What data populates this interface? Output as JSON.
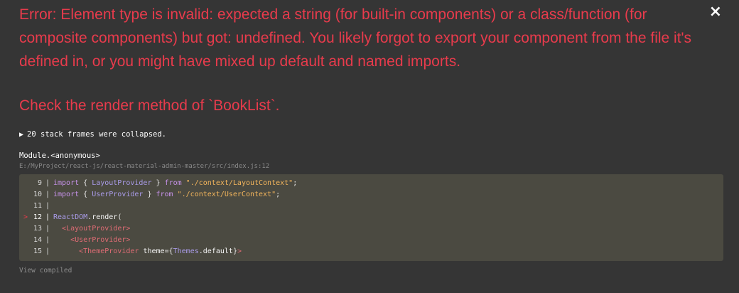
{
  "overlay": {
    "close_label": "×",
    "error_message": "Error: Element type is invalid: expected a string (for built-in components) or a class/function (for composite components) but got: undefined. You likely forgot to export your component from the file it's defined in, or you might have mixed up default and named imports.",
    "check_message": "Check the render method of `BookList`.",
    "collapsed_label": "20 stack frames were collapsed.",
    "frame": {
      "function": "Module.<anonymous>",
      "file": "E:/MyProject/react-js/react-material-admin-master/src/index.js:12"
    },
    "code_lines": [
      {
        "num": "9",
        "marker": "",
        "tokens": [
          [
            "kw",
            "import"
          ],
          [
            "br",
            " { "
          ],
          [
            "id",
            "LayoutProvider"
          ],
          [
            "br",
            " } "
          ],
          [
            "kw",
            "from"
          ],
          [
            "plain",
            " "
          ],
          [
            "str",
            "\"./context/LayoutContext\""
          ],
          [
            "plain",
            ";"
          ]
        ]
      },
      {
        "num": "10",
        "marker": "",
        "tokens": [
          [
            "kw",
            "import"
          ],
          [
            "br",
            " { "
          ],
          [
            "id",
            "UserProvider"
          ],
          [
            "br",
            " } "
          ],
          [
            "kw",
            "from"
          ],
          [
            "plain",
            " "
          ],
          [
            "str",
            "\"./context/UserContext\""
          ],
          [
            "plain",
            ";"
          ]
        ]
      },
      {
        "num": "11",
        "marker": "",
        "tokens": []
      },
      {
        "num": "12",
        "marker": ">",
        "tokens": [
          [
            "id",
            "ReactDOM"
          ],
          [
            "plain",
            "."
          ],
          [
            "fn",
            "render"
          ],
          [
            "plain",
            "("
          ]
        ]
      },
      {
        "num": "13",
        "marker": "",
        "tokens": [
          [
            "plain",
            "  "
          ],
          [
            "tag",
            "<LayoutProvider>"
          ]
        ]
      },
      {
        "num": "14",
        "marker": "",
        "tokens": [
          [
            "plain",
            "    "
          ],
          [
            "tag",
            "<UserProvider>"
          ]
        ]
      },
      {
        "num": "15",
        "marker": "",
        "tokens": [
          [
            "plain",
            "      "
          ],
          [
            "tag",
            "<ThemeProvider"
          ],
          [
            "plain",
            " "
          ],
          [
            "attr",
            "theme"
          ],
          [
            "plain",
            "="
          ],
          [
            "br",
            "{"
          ],
          [
            "id",
            "Themes"
          ],
          [
            "plain",
            "."
          ],
          [
            "fn",
            "default"
          ],
          [
            "br",
            "}"
          ],
          [
            "tag",
            ">"
          ]
        ]
      }
    ],
    "view_compiled_label": "View compiled"
  },
  "colors": {
    "background": "#353535",
    "error_red": "#e83b4c",
    "code_bg": "#4b4a41"
  },
  "icons": {
    "close": "close-icon",
    "expand": "triangle-right-icon"
  }
}
